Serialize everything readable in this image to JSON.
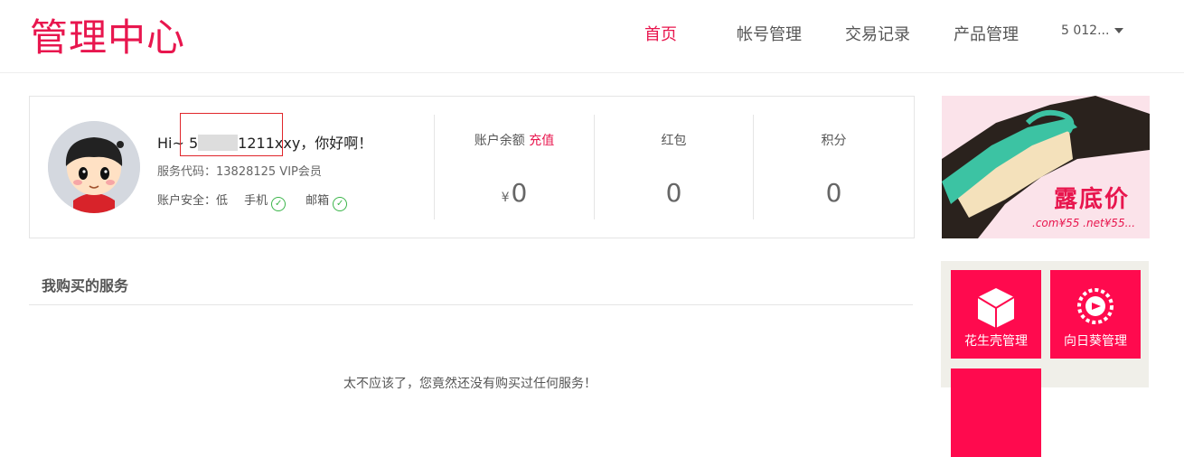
{
  "header": {
    "logo": "管理中心",
    "nav": [
      "首页",
      "帐号管理",
      "交易记录",
      "产品管理"
    ],
    "active_nav": "首页",
    "user": "5    012..."
  },
  "profile": {
    "greeting_prefix": "Hi~ 5",
    "greeting_name_suffix": "1211xxy",
    "greeting_suffix": "，你好啊！",
    "service_code": "服务代码：13828125   VIP会员",
    "security_label": "账户安全：低",
    "phone_label": "手机",
    "email_label": "邮箱",
    "stats": {
      "balance_label": "账户余额",
      "recharge_label": "充值",
      "balance_currency": "¥",
      "balance_value": "0",
      "redpacket_label": "红包",
      "redpacket_value": "0",
      "points_label": "积分",
      "points_value": "0"
    }
  },
  "services": {
    "title": "我购买的服务",
    "empty_message": "太不应该了，您竟然还没有购买过任何服务！"
  },
  "banner": {
    "title": "露底价",
    "subtitle": ".com¥55  .net¥55..."
  },
  "tiles": [
    {
      "label": "花生壳管理"
    },
    {
      "label": "向日葵管理"
    }
  ],
  "colors": {
    "brand": "#e8164e",
    "tile": "#ff0a4e",
    "check": "#3bb54a"
  }
}
